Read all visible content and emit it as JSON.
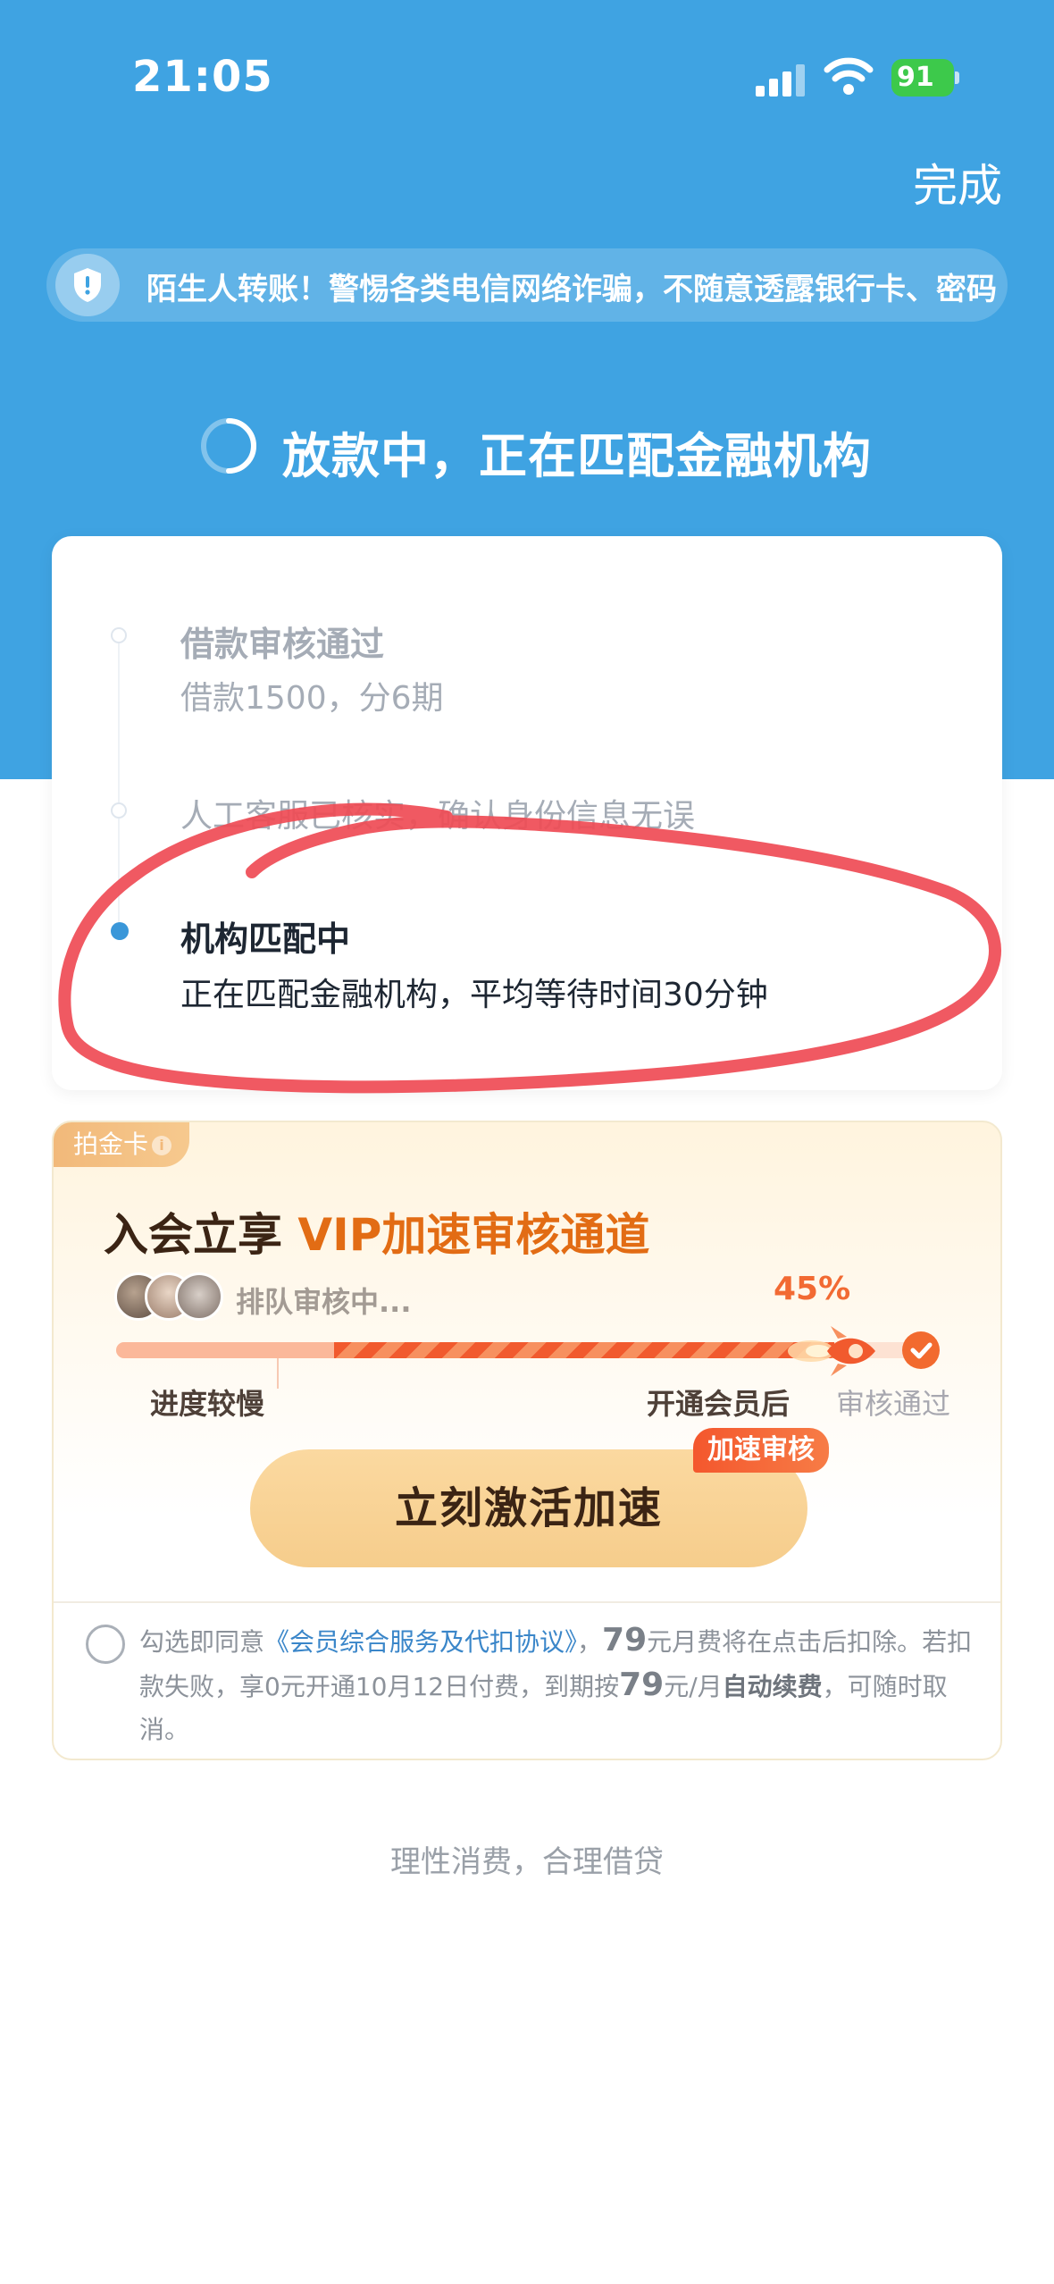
{
  "status_bar": {
    "time": "21:05",
    "battery": "91"
  },
  "header": {
    "done_label": "完成"
  },
  "warning": {
    "text": "陌生人转账！警惕各类电信网络诈骗，不随意透露银行卡、密码"
  },
  "status": {
    "title": "放款中，正在匹配金融机构"
  },
  "timeline": [
    {
      "title": "借款审核通过",
      "desc": "借款1500，分6期",
      "state": "done"
    },
    {
      "title": "",
      "desc": "人工客服已核实，确认身份信息无误",
      "state": "done"
    },
    {
      "title": "机构匹配中",
      "desc": "正在匹配金融机构，平均等待时间30分钟",
      "state": "active"
    }
  ],
  "vip": {
    "tag": "拍金卡",
    "tag_info": "i",
    "title_prefix": "入会立享 ",
    "title_highlight": "VIP加速审核通道",
    "queue_text": "排队审核中...",
    "percent": "45%",
    "progress_fraction": 0.86,
    "label_slow": "进度较慢",
    "label_after": "开通会员后",
    "label_pass": "审核通过",
    "badge": "加速审核",
    "cta": "立刻激活加速",
    "agreement": {
      "prefix": "勾选即同意",
      "link": "《会员综合服务及代扣协议》",
      "comma": "，",
      "fee1": "79",
      "mid1": "元月费将在点击后扣除。若扣款失败，享0元开通10月12日付费，到期按",
      "fee2": "79",
      "mid2": "元/月",
      "auto": "自动续费",
      "suffix": "，可随时取消。"
    }
  },
  "footer": {
    "text": "理性消费，合理借贷"
  },
  "colors": {
    "header_blue": "#3fa3e2",
    "accent_orange": "#f26a33",
    "active_dot": "#3a97d9"
  }
}
